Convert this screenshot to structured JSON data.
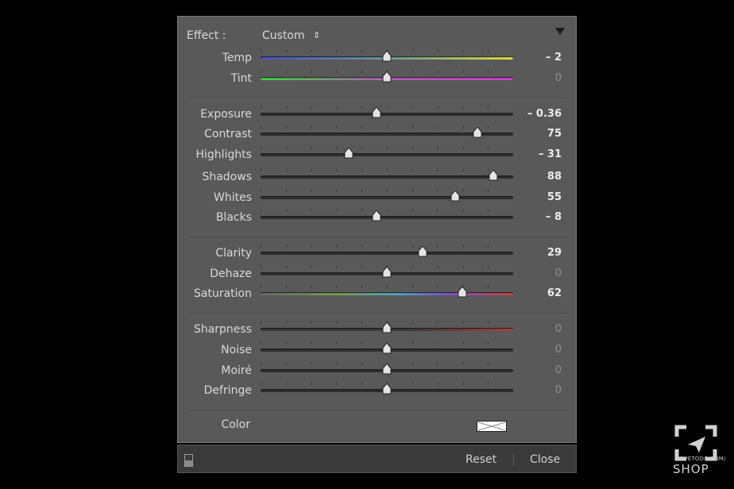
{
  "panel": {
    "effect_label": "Effect :",
    "effect_value": "Custom",
    "effect_arrows": "⇕",
    "collapse_icon": "triangle-down-icon"
  },
  "sliders": [
    {
      "label": "Temp",
      "value": "– 2",
      "position": 0.5,
      "track": "temp"
    },
    {
      "label": "Tint",
      "value": "0",
      "position": 0.5,
      "track": "tint"
    },
    {
      "label": "Exposure",
      "value": "– 0.36",
      "position": 0.46,
      "track": "plain"
    },
    {
      "label": "Contrast",
      "value": "75",
      "position": 0.86,
      "track": "plain"
    },
    {
      "label": "Highlights",
      "value": "– 31",
      "position": 0.35,
      "track": "plain"
    },
    {
      "label": "Shadows",
      "value": "88",
      "position": 0.92,
      "track": "plain"
    },
    {
      "label": "Whites",
      "value": "55",
      "position": 0.77,
      "track": "plain"
    },
    {
      "label": "Blacks",
      "value": "– 8",
      "position": 0.46,
      "track": "plain"
    },
    {
      "label": "Clarity",
      "value": "29",
      "position": 0.64,
      "track": "plain"
    },
    {
      "label": "Dehaze",
      "value": "0",
      "position": 0.5,
      "track": "plain"
    },
    {
      "label": "Saturation",
      "value": "62",
      "position": 0.8,
      "track": "sat"
    },
    {
      "label": "Sharpness",
      "value": "0",
      "position": 0.5,
      "track": "sharp"
    },
    {
      "label": "Noise",
      "value": "0",
      "position": 0.5,
      "track": "plain"
    },
    {
      "label": "Moiré",
      "value": "0",
      "position": 0.5,
      "track": "plain"
    },
    {
      "label": "Defringe",
      "value": "0",
      "position": 0.5,
      "track": "plain"
    }
  ],
  "color": {
    "label": "Color",
    "swatch": "#ffffff"
  },
  "footer": {
    "reset": "Reset",
    "close": "Close",
    "toggle_icon": "panel-toggle-icon"
  },
  "watermark": {
    "site": "ILOVETODO.COM/",
    "brand": "SHOP"
  }
}
